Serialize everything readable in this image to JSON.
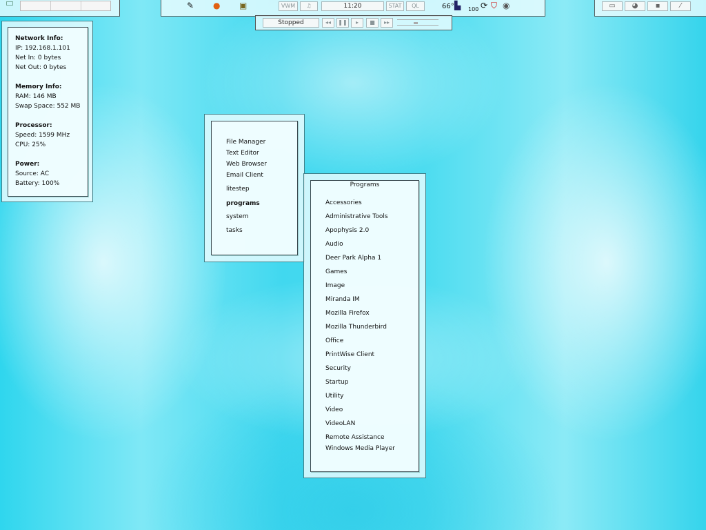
{
  "taskbar": {
    "clock": "11:20",
    "vwm": "VWM",
    "music": "♫",
    "stat": "STAT",
    "ql": "QL",
    "temperature": "66°",
    "battery_level": "100"
  },
  "player": {
    "status": "Stopped",
    "prev": "◂◂",
    "pause": "❚❚",
    "play": "▸",
    "stop": "■",
    "next": "▸▸",
    "volume": 0.45
  },
  "sysinfo": {
    "network_title": "Network Info:",
    "ip": "IP: 192.168.1.101",
    "net_in": "Net In: 0 bytes",
    "net_out": "Net Out: 0 bytes",
    "memory_title": "Memory Info:",
    "ram": "RAM: 146 MB",
    "swap": "Swap Space: 552 MB",
    "processor_title": "Processor:",
    "speed": "Speed: 1599 MHz",
    "cpu": "CPU: 25%",
    "power_title": "Power:",
    "source": "Source: AC",
    "battery": "Battery: 100%"
  },
  "main_menu": {
    "items": [
      "File Manager",
      "Text Editor",
      "Web Browser",
      "Email Client",
      "litestep",
      "programs",
      "system",
      "tasks"
    ]
  },
  "programs_menu": {
    "title": "Programs",
    "items": [
      "Accessories",
      "Administrative Tools",
      "Apophysis 2.0",
      "Audio",
      "Deer Park Alpha 1",
      "Games",
      "Image",
      "Miranda IM",
      "Mozilla Firefox",
      "Mozilla Thunderbird",
      "Office",
      "PrintWise Client",
      "Security",
      "Startup",
      "Utility",
      "Video",
      "VideoLAN",
      "Remote Assistance",
      "Windows Media Player"
    ]
  }
}
